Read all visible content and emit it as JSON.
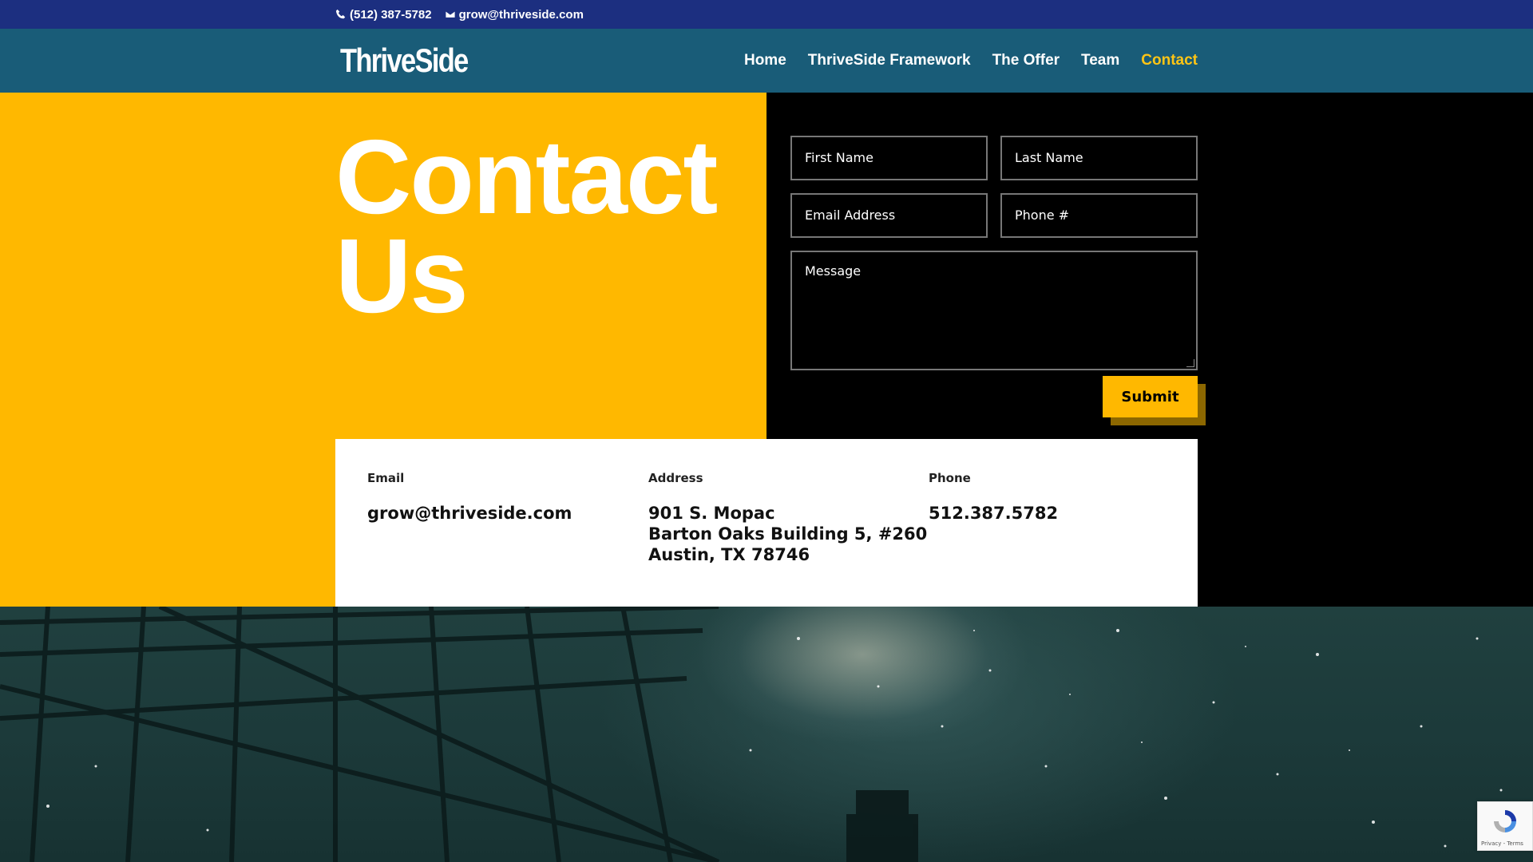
{
  "topbar": {
    "phone": "(512) 387-5782",
    "email": "grow@thriveside.com"
  },
  "header": {
    "logo_text": "ThriveSide",
    "nav": [
      {
        "label": "Home"
      },
      {
        "label": "ThriveSide Framework"
      },
      {
        "label": "The Offer"
      },
      {
        "label": "Team"
      },
      {
        "label": "Contact",
        "active": true
      }
    ]
  },
  "hero": {
    "title_line1": "Contact",
    "title_line2": "Us"
  },
  "form": {
    "first_name_placeholder": "First Name",
    "last_name_placeholder": "Last Name",
    "email_placeholder": "Email Address",
    "phone_placeholder": "Phone #",
    "message_placeholder": "Message",
    "submit_label": "Submit"
  },
  "info": {
    "email_label": "Email",
    "email_value": "grow@thriveside.com",
    "address_label": "Address",
    "address_line1": "901 S. Mopac",
    "address_line2": "Barton Oaks Building 5, #260",
    "address_line3": "Austin, TX 78746",
    "phone_label": "Phone",
    "phone_value": "512.387.5782"
  },
  "recaptcha": {
    "links": "Privacy - Terms"
  },
  "colors": {
    "topbar": "#1c2f80",
    "header": "#195c78",
    "accent": "#ffb800",
    "nav_active": "#ffc515"
  }
}
